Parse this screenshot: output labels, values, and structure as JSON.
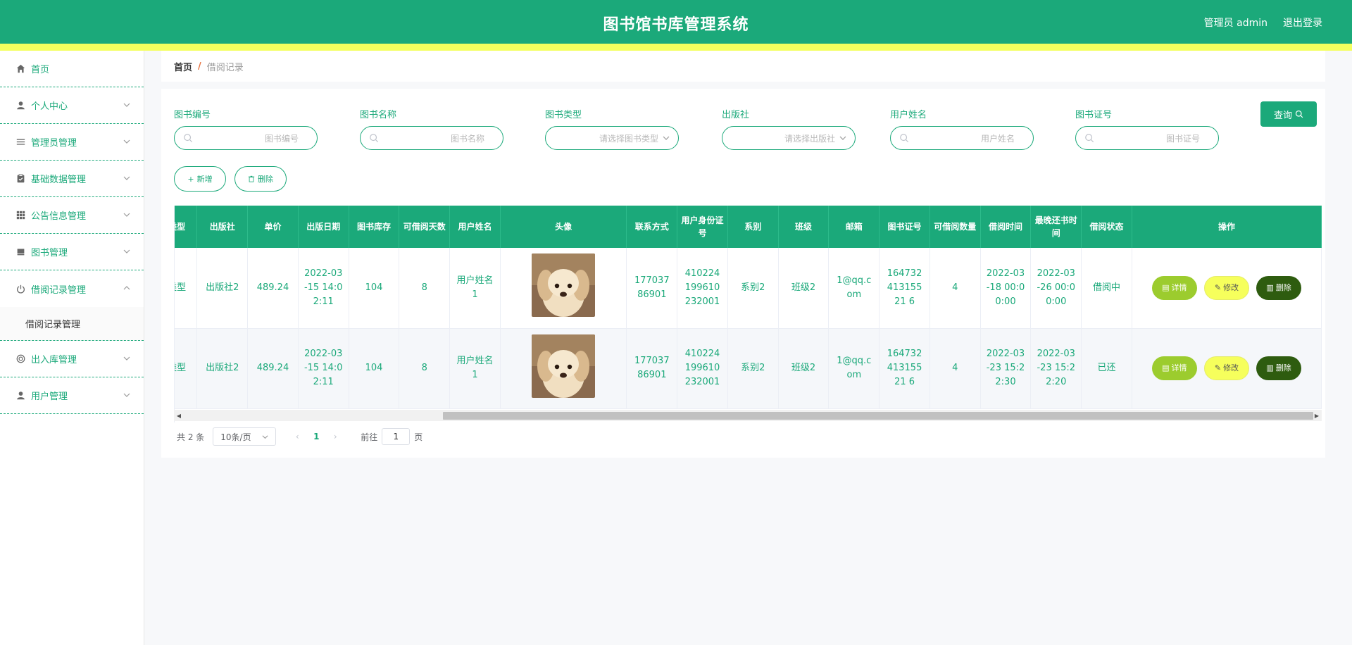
{
  "header": {
    "title": "图书馆书库管理系统",
    "user": "管理员 admin",
    "logout": "退出登录"
  },
  "sidebar": {
    "items": [
      {
        "label": "首页",
        "icon": "home-icon"
      },
      {
        "label": "个人中心",
        "icon": "user-icon"
      },
      {
        "label": "管理员管理",
        "icon": "list-icon"
      },
      {
        "label": "基础数据管理",
        "icon": "clipboard-icon"
      },
      {
        "label": "公告信息管理",
        "icon": "grid-icon"
      },
      {
        "label": "图书管理",
        "icon": "book-icon"
      },
      {
        "label": "借阅记录管理",
        "icon": "power-icon"
      },
      {
        "label": "出入库管理",
        "icon": "circle-icon"
      },
      {
        "label": "用户管理",
        "icon": "user-icon"
      }
    ],
    "sub_item": "借阅记录管理"
  },
  "breadcrumb": {
    "home": "首页",
    "sep": "/",
    "current": "借阅记录"
  },
  "filters": [
    {
      "label": "图书编号",
      "placeholder": "图书编号"
    },
    {
      "label": "图书名称",
      "placeholder": "图书名称"
    },
    {
      "label": "图书类型",
      "placeholder": "请选择图书类型"
    },
    {
      "label": "出版社",
      "placeholder": "请选择出版社"
    },
    {
      "label": "用户姓名",
      "placeholder": "用户姓名"
    },
    {
      "label": "图书证号",
      "placeholder": "图书证号"
    }
  ],
  "buttons": {
    "query": "查询",
    "add": "新增",
    "delete": "删除"
  },
  "table": {
    "headers": [
      "类型",
      "出版社",
      "单价",
      "出版日期",
      "图书库存",
      "可借阅天数",
      "用户姓名",
      "头像",
      "联系方式",
      "用户身份证号",
      "系别",
      "班级",
      "邮箱",
      "图书证号",
      "可借阅数量",
      "借阅时间",
      "最晚还书时间",
      "借阅状态",
      "操作"
    ],
    "rows": [
      [
        "类型",
        "出版社2",
        "489.24",
        "2022-03-15 14:02:11",
        "104",
        "8",
        "用户姓名1",
        "",
        "17703786901",
        "410224199610232001",
        "系别2",
        "班级2",
        "1@qq.com",
        "16473241315521 6",
        "4",
        "2022-03-18 00:00:00",
        "2022-03-26 00:00:00",
        "借阅中"
      ],
      [
        "类型",
        "出版社2",
        "489.24",
        "2022-03-15 14:02:11",
        "104",
        "8",
        "用户姓名1",
        "",
        "17703786901",
        "410224199610232001",
        "系别2",
        "班级2",
        "1@qq.com",
        "16473241315521 6",
        "4",
        "2022-03-23 15:22:30",
        "2022-03-23 15:22:20",
        "已还"
      ]
    ],
    "actions": {
      "detail": "详情",
      "edit": "修改",
      "delete": "删除"
    }
  },
  "pagination": {
    "total": "共 2 条",
    "page_size": "10条/页",
    "current": "1",
    "goto": "前往",
    "goto_value": "1",
    "page_unit": "页"
  },
  "colors": {
    "primary": "#1ba97a",
    "stripe": "#f4ff5e",
    "detail": "#9ccc2e",
    "edit": "#f6ff5c",
    "delete": "#2e5c0f"
  }
}
